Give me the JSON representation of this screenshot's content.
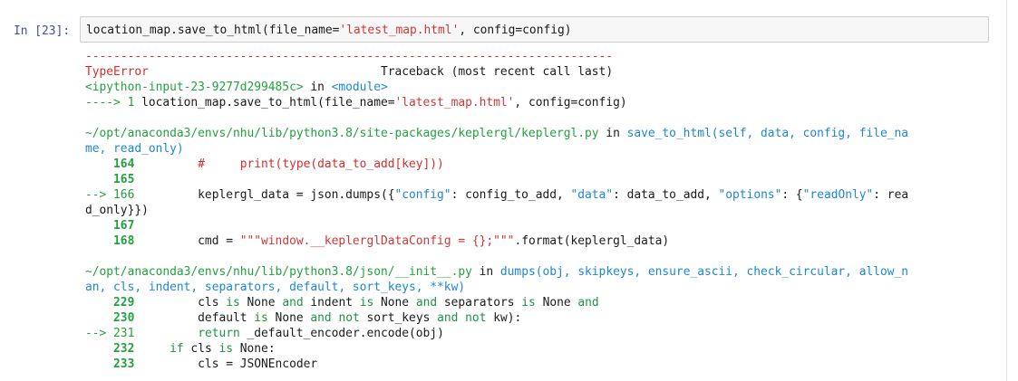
{
  "cell": {
    "prompt": "In [23]:",
    "input_segments": [
      {
        "t": "location_map.save_to_html(file_name=",
        "c": "plain"
      },
      {
        "t": "'latest_map.html'",
        "c": "str"
      },
      {
        "t": ", config=config)",
        "c": "plain"
      }
    ]
  },
  "output_lines": [
    {
      "segments": [
        {
          "t": "---------------------------------------------------------------------------",
          "c": "red"
        }
      ]
    },
    {
      "segments": [
        {
          "t": "TypeError",
          "c": "red"
        },
        {
          "t": "                                 Traceback (most recent call last)",
          "c": "plain"
        }
      ]
    },
    {
      "segments": [
        {
          "t": "<ipython-input-23-9277d299485c>",
          "c": "green"
        },
        {
          "t": " in ",
          "c": "plain"
        },
        {
          "t": "<module>",
          "c": "blue"
        }
      ]
    },
    {
      "segments": [
        {
          "t": "----> 1",
          "c": "green"
        },
        {
          "t": " location_map.save_to_html(file_name=",
          "c": "plain"
        },
        {
          "t": "'latest_map.html'",
          "c": "str"
        },
        {
          "t": ", config=config)",
          "c": "plain"
        }
      ]
    },
    {
      "gap": true
    },
    {
      "segments": [
        {
          "t": "~/opt/anaconda3/envs/nhu/lib/python3.8/site-packages/keplergl/keplergl.py",
          "c": "green"
        },
        {
          "t": " in ",
          "c": "plain"
        },
        {
          "t": "save_to_html(self, data, config, file_na",
          "c": "blue"
        }
      ]
    },
    {
      "segments": [
        {
          "t": "me, read_only)",
          "c": "blue"
        }
      ]
    },
    {
      "segments": [
        {
          "t": "    164",
          "c": "lno"
        },
        {
          "t": "         ",
          "c": "plain"
        },
        {
          "t": "#     print(type(data_to_add[key]))",
          "c": "red"
        }
      ]
    },
    {
      "segments": [
        {
          "t": "    165",
          "c": "lno"
        }
      ]
    },
    {
      "segments": [
        {
          "t": "--> 166",
          "c": "green"
        },
        {
          "t": "         keplergl_data = json.dumps({",
          "c": "plain"
        },
        {
          "t": "\"config\"",
          "c": "blue"
        },
        {
          "t": ": config_to_add, ",
          "c": "plain"
        },
        {
          "t": "\"data\"",
          "c": "blue"
        },
        {
          "t": ": data_to_add, ",
          "c": "plain"
        },
        {
          "t": "\"options\"",
          "c": "blue"
        },
        {
          "t": ": {",
          "c": "plain"
        },
        {
          "t": "\"readOnly\"",
          "c": "blue"
        },
        {
          "t": ": rea",
          "c": "plain"
        }
      ]
    },
    {
      "segments": [
        {
          "t": "d_only}})",
          "c": "plain"
        }
      ]
    },
    {
      "segments": [
        {
          "t": "    167",
          "c": "lno"
        }
      ]
    },
    {
      "segments": [
        {
          "t": "    168",
          "c": "lno"
        },
        {
          "t": "         cmd = ",
          "c": "plain"
        },
        {
          "t": "\"\"\"window.__keplerglDataConfig = {};\"\"\"",
          "c": "str"
        },
        {
          "t": ".format(keplergl_data)",
          "c": "plain"
        }
      ]
    },
    {
      "gap": true
    },
    {
      "segments": [
        {
          "t": "~/opt/anaconda3/envs/nhu/lib/python3.8/json/__init__.py",
          "c": "green"
        },
        {
          "t": " in ",
          "c": "plain"
        },
        {
          "t": "dumps(obj, skipkeys, ensure_ascii, check_circular, allow_n",
          "c": "blue"
        }
      ]
    },
    {
      "segments": [
        {
          "t": "an, cls, indent, separators, default, sort_keys, **kw)",
          "c": "blue"
        }
      ]
    },
    {
      "segments": [
        {
          "t": "    229",
          "c": "lno"
        },
        {
          "t": "         cls ",
          "c": "plain"
        },
        {
          "t": "is",
          "c": "kw"
        },
        {
          "t": " None ",
          "c": "plain"
        },
        {
          "t": "and",
          "c": "kw"
        },
        {
          "t": " indent ",
          "c": "plain"
        },
        {
          "t": "is",
          "c": "kw"
        },
        {
          "t": " None ",
          "c": "plain"
        },
        {
          "t": "and",
          "c": "kw"
        },
        {
          "t": " separators ",
          "c": "plain"
        },
        {
          "t": "is",
          "c": "kw"
        },
        {
          "t": " None ",
          "c": "plain"
        },
        {
          "t": "and",
          "c": "kw"
        }
      ]
    },
    {
      "segments": [
        {
          "t": "    230",
          "c": "lno"
        },
        {
          "t": "         default ",
          "c": "plain"
        },
        {
          "t": "is",
          "c": "kw"
        },
        {
          "t": " None ",
          "c": "plain"
        },
        {
          "t": "and",
          "c": "kw"
        },
        {
          "t": " ",
          "c": "plain"
        },
        {
          "t": "not",
          "c": "kw"
        },
        {
          "t": " sort_keys ",
          "c": "plain"
        },
        {
          "t": "and",
          "c": "kw"
        },
        {
          "t": " ",
          "c": "plain"
        },
        {
          "t": "not",
          "c": "kw"
        },
        {
          "t": " kw):",
          "c": "plain"
        }
      ]
    },
    {
      "segments": [
        {
          "t": "--> 231",
          "c": "green"
        },
        {
          "t": "         ",
          "c": "plain"
        },
        {
          "t": "return",
          "c": "kw"
        },
        {
          "t": " _default_encoder.encode(obj)",
          "c": "plain"
        }
      ]
    },
    {
      "segments": [
        {
          "t": "    232",
          "c": "lno"
        },
        {
          "t": "     ",
          "c": "plain"
        },
        {
          "t": "if",
          "c": "kw"
        },
        {
          "t": " cls ",
          "c": "plain"
        },
        {
          "t": "is",
          "c": "kw"
        },
        {
          "t": " None:",
          "c": "plain"
        }
      ]
    },
    {
      "segments": [
        {
          "t": "    233",
          "c": "lno"
        },
        {
          "t": "         cls = JSONEncoder",
          "c": "plain"
        }
      ]
    }
  ]
}
